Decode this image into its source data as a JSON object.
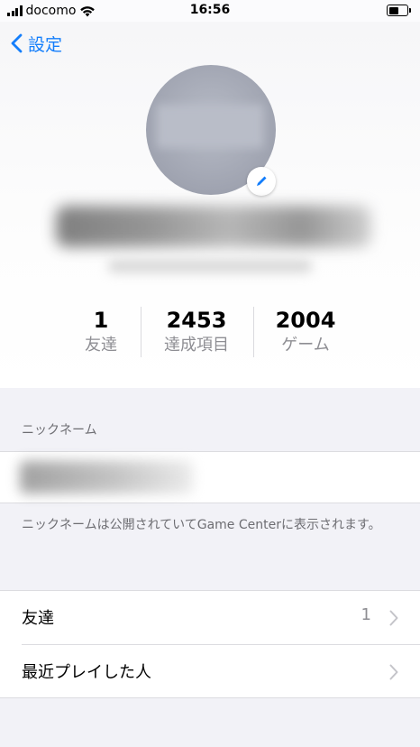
{
  "status_bar": {
    "carrier": "docomo",
    "time": "16:56"
  },
  "nav": {
    "back_label": "設定"
  },
  "stats": [
    {
      "value": "1",
      "label": "友達"
    },
    {
      "value": "2453",
      "label": "達成項目"
    },
    {
      "value": "2004",
      "label": "ゲーム"
    }
  ],
  "nickname_section": {
    "header": "ニックネーム",
    "footer": "ニックネームは公開されていてGame Centerに表示されます。"
  },
  "list": [
    {
      "label": "友達",
      "value": "1"
    },
    {
      "label": "最近プレイした人",
      "value": ""
    }
  ],
  "colors": {
    "accent": "#147efb",
    "secondary_text": "#8e8e93",
    "background": "#f2f2f7"
  },
  "icons": [
    "back-chevron-icon",
    "pencil-icon",
    "chevron-right-icon",
    "wifi-icon",
    "battery-icon",
    "signal-icon"
  ]
}
